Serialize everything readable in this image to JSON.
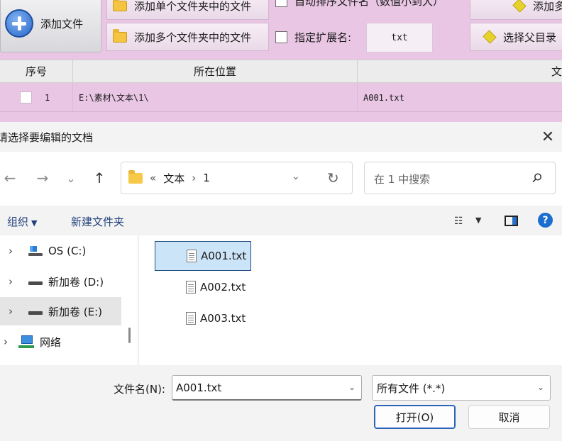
{
  "app": {
    "toolbar": {
      "add_file": "添加文件",
      "add_single_folder": "添加单个文件夹中的文件",
      "add_multi_folder": "添加多个文件夹中的文件",
      "auto_sort": "自动排序文件名（数值小到大）",
      "specify_ext": "指定扩展名:",
      "ext_value": "txt",
      "add_right_top": "添加多",
      "choose_parent": "选择父目录"
    },
    "grid": {
      "headers": [
        "序号",
        "所在位置",
        "文"
      ],
      "row": {
        "index": "1",
        "location": "E:\\素材\\文本\\1\\",
        "filename": "A001.txt"
      }
    }
  },
  "dialog": {
    "title": "请选择要编辑的文档",
    "close_glyph": "✕",
    "nav": {
      "back": "←",
      "forward": "→",
      "recent": "⌄",
      "up": "↑"
    },
    "address": {
      "overflow": "«",
      "segments": [
        "文本",
        "1"
      ],
      "sep": "›",
      "dropdown": "⌄",
      "refresh": "↻"
    },
    "search": {
      "placeholder": "在 1 中搜索"
    },
    "command_bar": {
      "organize": "组织",
      "new_folder": "新建文件夹",
      "dropdown_glyph": "▼",
      "view_glyph": "☷"
    },
    "help_glyph": "?",
    "nav_pane": [
      {
        "label": "OS (C:)",
        "icon": "os-drive-icon",
        "selected": false
      },
      {
        "label": "新加卷 (D:)",
        "icon": "drive-icon",
        "selected": false
      },
      {
        "label": "新加卷 (E:)",
        "icon": "drive-icon",
        "selected": true
      },
      {
        "label": "网络",
        "icon": "network-icon",
        "selected": false
      }
    ],
    "chevron": "›",
    "files": [
      {
        "name": "A001.txt",
        "selected": true
      },
      {
        "name": "A002.txt",
        "selected": false
      },
      {
        "name": "A003.txt",
        "selected": false
      }
    ],
    "filename_label": "文件名(N):",
    "filename_value": "A001.txt",
    "file_type": "所有文件 (*.*)",
    "open_button": "打开(O)",
    "cancel_button": "取消",
    "select_chevron": "⌄"
  },
  "colors": {
    "app_bg": "#e9c6e4",
    "selection_bg": "#cce4f7",
    "accent": "#1c6dd0"
  }
}
